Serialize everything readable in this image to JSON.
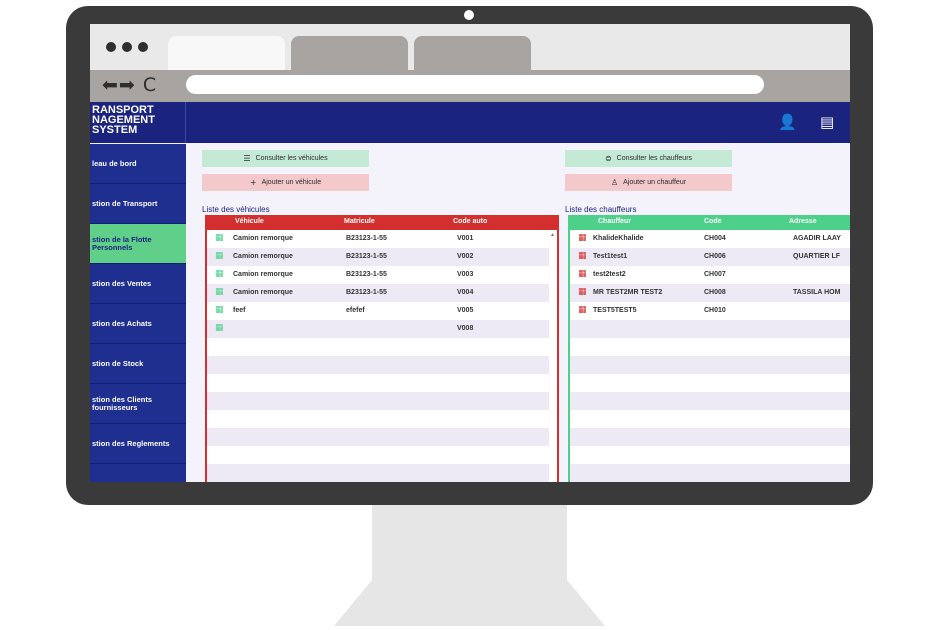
{
  "browser": {
    "window_controls": [
      "●",
      "●",
      "●"
    ],
    "nav_icons": "⬅➡ C"
  },
  "app": {
    "brand": "RANSPORT\nNAGEMENT\nSYSTEM",
    "top_icons": {
      "user": "👤",
      "document": "▤"
    },
    "sidebar": [
      {
        "label": "leau de bord"
      },
      {
        "label": "stion de Transport"
      },
      {
        "label": "stion de la Flotte\nPersonnels",
        "active": true
      },
      {
        "label": "stion des Ventes"
      },
      {
        "label": "stion des Achats"
      },
      {
        "label": "stion de Stock"
      },
      {
        "label": "stion des Clients\nfournisseurs"
      },
      {
        "label": "stion des Reglements"
      }
    ],
    "vehicles": {
      "consult_label": "Consulter les véhicules",
      "add_label": "Ajouter un véhicule",
      "title": "Liste des véhicules",
      "header_color": "#d32f2f",
      "columns": [
        "Véhicule",
        "Matricule",
        "Code auto"
      ],
      "rows": [
        [
          "Camion remorque",
          "B23123-1-55",
          "V001"
        ],
        [
          "Camion remorque",
          "B23123-1-55",
          "V002"
        ],
        [
          "Camion remorque",
          "B23123-1-55",
          "V003"
        ],
        [
          "Camion remorque",
          "B23123-1-55",
          "V004"
        ],
        [
          "feef",
          "efefef",
          "V005"
        ],
        [
          "",
          "",
          "V008"
        ]
      ]
    },
    "drivers": {
      "consult_label": "Consulter les chauffeurs",
      "add_label": "Ajouter un chauffeur",
      "title": "Liste des chauffeurs",
      "header_color": "#4cd08a",
      "columns": [
        "Chauffeur",
        "Code",
        "Adresse"
      ],
      "rows": [
        [
          "KhalideKhalide",
          "CH004",
          "AGADIR LAAY"
        ],
        [
          "Test1test1",
          "CH006",
          "QUARTIER LF"
        ],
        [
          "test2test2",
          "CH007",
          ""
        ],
        [
          "MR TEST2MR TEST2",
          "CH008",
          "TASSILA HOM"
        ],
        [
          "TEST5TEST5",
          "CH010",
          ""
        ]
      ]
    }
  }
}
